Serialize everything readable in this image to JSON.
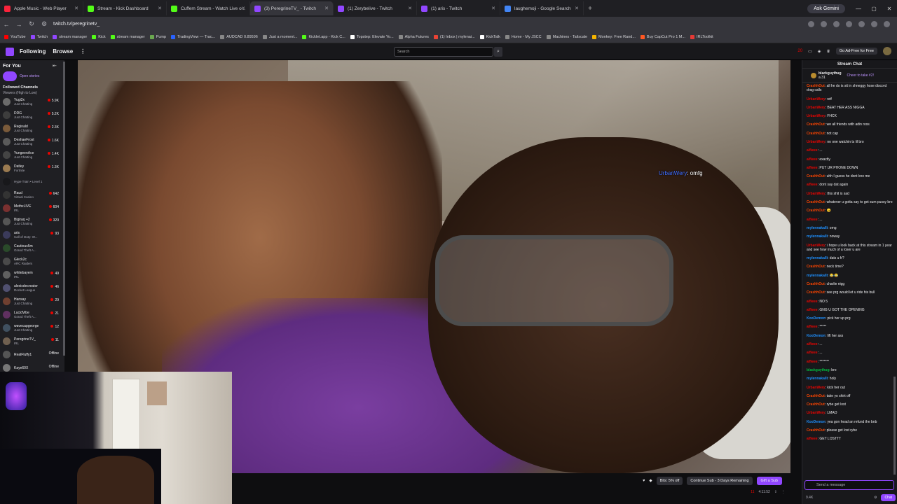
{
  "tabs": [
    {
      "label": "Apple Music - Web Player",
      "color": "#fa233b"
    },
    {
      "label": "Stream - Kick Dashboard",
      "color": "#53fc18"
    },
    {
      "label": "Cuffem Stream - Watch Live o...",
      "color": "#53fc18"
    },
    {
      "label": "(3) PeregrineTV_ - Twitch",
      "color": "#9147ff"
    },
    {
      "label": "(1) Zerybelive - Twitch",
      "color": "#9147ff"
    },
    {
      "label": "(1) aris - Twitch",
      "color": "#9147ff"
    },
    {
      "label": "laughemoji - Google Search",
      "color": "#4285f4"
    }
  ],
  "ask_gemini": "Ask Gemini",
  "url": "twitch.tv/peregrinetv_",
  "bookmarks": [
    {
      "label": "YouTube",
      "color": "#ff0000"
    },
    {
      "label": "Twitch",
      "color": "#9147ff"
    },
    {
      "label": "stream manager",
      "color": "#9147ff"
    },
    {
      "label": "Kick",
      "color": "#53fc18"
    },
    {
      "label": "stream manager",
      "color": "#53fc18"
    },
    {
      "label": "Pump",
      "color": "#6aa84f"
    },
    {
      "label": "TradingView — Trac...",
      "color": "#2962ff"
    },
    {
      "label": "AUDCAD 0.89596",
      "color": "#888888"
    },
    {
      "label": "Just a moment...",
      "color": "#888888"
    },
    {
      "label": "Kicklet.app - Kick C...",
      "color": "#53fc18"
    },
    {
      "label": "Topstep: Elevate Yo...",
      "color": "#ffffff"
    },
    {
      "label": "Alpha Futures",
      "color": "#888888"
    },
    {
      "label": "(1) Inbox | mylenai...",
      "color": "#ea4335"
    },
    {
      "label": "KickTalk",
      "color": "#ffffff"
    },
    {
      "label": "Home - My JSCC",
      "color": "#888888"
    },
    {
      "label": "Machines - Tailscale",
      "color": "#888888"
    },
    {
      "label": "Monkey: Free Rand...",
      "color": "#f4b400"
    },
    {
      "label": "Buy CapCut Pro 1 M...",
      "color": "#ff5722"
    },
    {
      "label": "IRLToolkit",
      "color": "#e53935"
    }
  ],
  "nav": {
    "following": "Following",
    "browse": "Browse",
    "search_placeholder": "Search",
    "ad_free": "Go Ad-Free for Free",
    "notif_count": "20"
  },
  "sidebar": {
    "for_you": "For You",
    "open_stories": "Open stories",
    "followed": "Followed Channels",
    "sort": "Viewers (High to Low)",
    "channels": [
      {
        "name": "Yugi2x",
        "cat": "Just Chatting",
        "viewers": "5.9K",
        "color": "#6b6b6b"
      },
      {
        "name": "DDG",
        "cat": "Just Chatting",
        "viewers": "5.2K",
        "color": "#3d3d3d"
      },
      {
        "name": "Reginald",
        "cat": "Just Chatting",
        "viewers": "2.3K",
        "color": "#7a5a3a"
      },
      {
        "name": "DeshaeFrost",
        "cat": "Just Chatting",
        "viewers": "1.6K",
        "color": "#5a5a5a"
      },
      {
        "name": "YungeenAce",
        "cat": "Just Chatting",
        "viewers": "1.4K",
        "color": "#444"
      },
      {
        "name": "Datley",
        "cat": "Fortnite",
        "viewers": "1.3K",
        "color": "#9a7a50"
      },
      {
        "name": "",
        "cat": "Hype Train • Level 1",
        "viewers": "",
        "color": "#18181b"
      },
      {
        "name": "Raud",
        "cat": "Virtual Casino",
        "viewers": "642",
        "color": "#333"
      },
      {
        "name": "MethxLIVE",
        "cat": "IRL",
        "viewers": "604",
        "color": "#7a3030"
      },
      {
        "name": "Bigiraq +2",
        "cat": "Just Chatting",
        "viewers": "320",
        "color": "#555"
      },
      {
        "name": "aris",
        "cat": "Call of Duty: W...",
        "viewers": "93",
        "color": "#3a3a5a"
      },
      {
        "name": "Cautious5m",
        "cat": "Grand Theft A...",
        "viewers": "",
        "color": "#2a4a2a"
      },
      {
        "name": "Gleck2c",
        "cat": "ARC Raiders",
        "viewers": "",
        "color": "#4a4a4a"
      },
      {
        "name": "whitebayem",
        "cat": "IRL",
        "viewers": "49",
        "color": "#606060"
      },
      {
        "name": "alexisdecreator",
        "cat": "Rocket League",
        "viewers": "46",
        "color": "#505070"
      },
      {
        "name": "Hansay",
        "cat": "Just Chatting",
        "viewers": "29",
        "color": "#704030"
      },
      {
        "name": "LucidVibe",
        "cat": "Grand Theft A...",
        "viewers": "21",
        "color": "#603060"
      },
      {
        "name": "wavecapgeorge",
        "cat": "Just Chatting",
        "viewers": "12",
        "color": "#405060"
      },
      {
        "name": "PeregrineTV_",
        "cat": "IRL",
        "viewers": "11",
        "color": "#706050"
      },
      {
        "name": "RealFluffy1",
        "cat": "",
        "viewers": "Offline",
        "color": "#555"
      },
      {
        "name": "Kaye60X",
        "cat": "",
        "viewers": "Offline",
        "color": "#777"
      },
      {
        "name": "MistyFoster",
        "cat": "",
        "viewers": "Offline",
        "color": "#666"
      }
    ]
  },
  "overlay": {
    "user": "UrbanWery",
    "text": ": omfg"
  },
  "player": {
    "bits": "Bits: 5% off",
    "continue": "Continue Sub - 3 Days Remaining",
    "gift": "Gift a Sub",
    "viewers": "11",
    "uptime": "4:11:52"
  },
  "chat": {
    "title": "Stream Chat",
    "pinned_user": "blackguythug",
    "pinned_amt": "a 31",
    "cheer": "Cheer to take #2!",
    "messages": [
      {
        "u": "CrashhOut",
        "c": "#ff4500",
        "t": "all he do is sit in shneggy hose discord drag calls"
      },
      {
        "u": "UrbanWery",
        "c": "#eb0400",
        "t": "wtf"
      },
      {
        "u": "UrbanWery",
        "c": "#eb0400",
        "t": "BEAT HER ASS NIGGA"
      },
      {
        "u": "UrbanWery",
        "c": "#eb0400",
        "t": "FHCK"
      },
      {
        "u": "CrashhOut",
        "c": "#ff4500",
        "t": "we all friends with adin ross"
      },
      {
        "u": "CrashhOut",
        "c": "#ff4500",
        "t": "not cap"
      },
      {
        "u": "UrbanWery",
        "c": "#eb0400",
        "t": "no one watchin ts lil bro"
      },
      {
        "u": "alfieee",
        "c": "#eb0400",
        "t": "..."
      },
      {
        "u": "alfieee",
        "c": "#eb0400",
        "t": "exactly"
      },
      {
        "u": "alfieee",
        "c": "#eb0400",
        "t": "PUT UR PHONE DOWN"
      },
      {
        "u": "CrashhOut",
        "c": "#ff4500",
        "t": "uhh I guess he dont kno me"
      },
      {
        "u": "alfieee",
        "c": "#eb0400",
        "t": "dont say dat again"
      },
      {
        "u": "UrbanWery",
        "c": "#eb0400",
        "t": "this shit is sad"
      },
      {
        "u": "CrashhOut",
        "c": "#ff4500",
        "t": "whatever u gotta say to get sum pussy bro"
      },
      {
        "u": "CrashhOut",
        "c": "#ff4500",
        "t": "😠"
      },
      {
        "u": "alfieee",
        "c": "#eb0400",
        "t": "..."
      },
      {
        "u": "mylennakalli",
        "c": "#1e90ff",
        "t": "omg"
      },
      {
        "u": "mylennakalli",
        "c": "#1e90ff",
        "t": "noway"
      },
      {
        "u": "UrbanWery",
        "c": "#eb0400",
        "t": "i hope u look back at this stream in 1 year and see how much of a loser u are"
      },
      {
        "u": "mylennakalli",
        "c": "#1e90ff",
        "t": "dats u fr?"
      },
      {
        "u": "CrashhOut",
        "c": "#ff4500",
        "t": "neck time?"
      },
      {
        "u": "mylennakalli",
        "c": "#1e90ff",
        "t": "😂😂"
      },
      {
        "u": "CrashhOut",
        "c": "#ff4500",
        "t": "charlie nigg"
      },
      {
        "u": "CrashhOut",
        "c": "#ff4500",
        "t": "see prg would let u ride his bull"
      },
      {
        "u": "alfieee",
        "c": "#eb0400",
        "t": "NO 5"
      },
      {
        "u": "alfieee",
        "c": "#eb0400",
        "t": "GNG U GOT THE OPENING"
      },
      {
        "u": "KooDemon",
        "c": "#1e90ff",
        "t": "pick her up prg"
      },
      {
        "u": "alfieee",
        "c": "#eb0400",
        "t": "*****"
      },
      {
        "u": "KooDemon",
        "c": "#1e90ff",
        "t": "lift her ass"
      },
      {
        "u": "alfieee",
        "c": "#eb0400",
        "t": "..."
      },
      {
        "u": "alfieee",
        "c": "#eb0400",
        "t": "..."
      },
      {
        "u": "alfieee",
        "c": "#eb0400",
        "t": "*******"
      },
      {
        "u": "blackguythug",
        "c": "#00c040",
        "t": "bro"
      },
      {
        "u": "mylennakalli",
        "c": "#1e90ff",
        "t": "holy"
      },
      {
        "u": "UrbanWery",
        "c": "#eb0400",
        "t": "kick her out"
      },
      {
        "u": "CrashhOut",
        "c": "#ff4500",
        "t": "take yo shirt off"
      },
      {
        "u": "CrashhOut",
        "c": "#ff4500",
        "t": "rybe get lost"
      },
      {
        "u": "UrbanWery",
        "c": "#eb0400",
        "t": "LMAO"
      },
      {
        "u": "KooDemon",
        "c": "#1e90ff",
        "t": "yea gon head an refund the bnb"
      },
      {
        "u": "CrashhOut",
        "c": "#ff4500",
        "t": "please get lost rybe"
      },
      {
        "u": "alfieee",
        "c": "#eb0400",
        "t": "GET LOSTTT"
      }
    ],
    "input_placeholder": "Send a message",
    "points": "9.4K",
    "chat_btn": "Chat"
  }
}
